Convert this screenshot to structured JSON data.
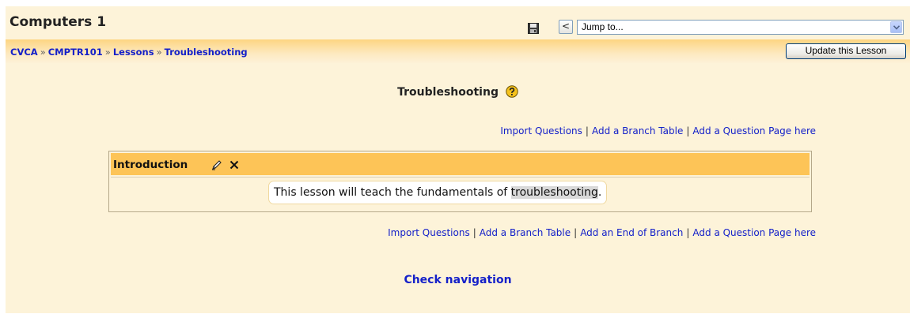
{
  "header": {
    "course_title": "Computers 1",
    "jump_select": {
      "selected": "Jump to..."
    },
    "prev_label": "<"
  },
  "navbar": {
    "breadcrumb": [
      "CVCA",
      "CMPTR101",
      "Lessons",
      "Troubleshooting"
    ],
    "separator": "»",
    "update_button": "Update this Lesson"
  },
  "main": {
    "lesson_title": "Troubleshooting",
    "actions_top": [
      "Import Questions",
      "Add a Branch Table",
      "Add a Question Page here"
    ],
    "actions_bottom": [
      "Import Questions",
      "Add a Branch Table",
      "Add an End of Branch",
      "Add a Question Page here"
    ],
    "page": {
      "title": "Introduction",
      "content_before": "This lesson will teach the fundamentals of ",
      "content_highlight": "troubleshooting",
      "content_after": "."
    },
    "check_navigation": "Check navigation"
  },
  "icons": [
    "save-icon",
    "help-icon",
    "edit-icon",
    "delete-icon",
    "chevron-down-icon"
  ],
  "colors": {
    "page_bg": "#fdf3d9",
    "header_row": "#fdc457",
    "link": "#1420c9"
  }
}
